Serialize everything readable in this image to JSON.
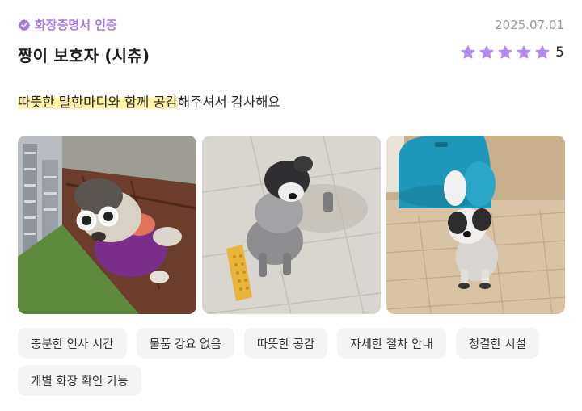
{
  "review": {
    "badge": {
      "label": "화장증명서 인증",
      "icon": "verified-badge-icon",
      "color": "#a67be0"
    },
    "date": "2025.07.01",
    "author_pet": "짱이 보호자 (시츄)",
    "rating": {
      "value": "5",
      "stars_filled": 5,
      "star_color": "#b48bf0"
    },
    "text_highlighted": "따뜻한 말한마디와 함께 공감",
    "text_rest": "해주셔서 감사해요",
    "highlight_color": "#fff3a6",
    "tags": [
      "충분한 인사 시간",
      "물품 강요 없음",
      "따뜻한 공감",
      "자세한 절차 안내",
      "청결한 시설",
      "개별 화장 확인 가능"
    ]
  }
}
